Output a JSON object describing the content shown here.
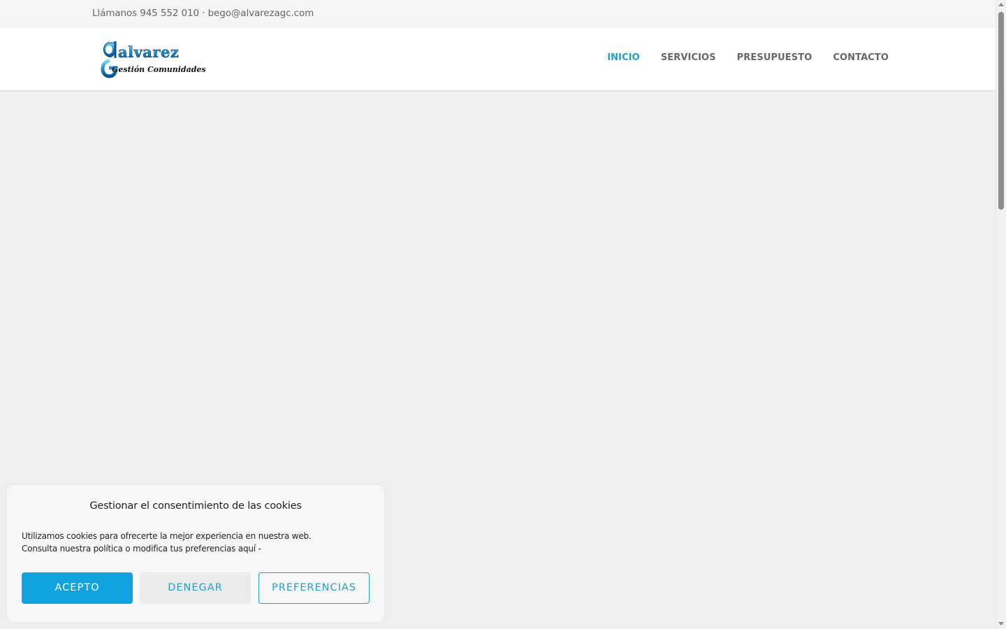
{
  "topbar": {
    "contact_text": "Llámanos 945 552 010 · bego@alvarezagc.com"
  },
  "header": {
    "logo": {
      "line1": "alvarez",
      "line2": "Gestión Comunidades"
    },
    "nav": [
      {
        "label": "INICIO",
        "active": true
      },
      {
        "label": "SERVICIOS",
        "active": false
      },
      {
        "label": "PRESUPUESTO",
        "active": false
      },
      {
        "label": "CONTACTO",
        "active": false
      }
    ]
  },
  "cookie_banner": {
    "title": "Gestionar el consentimiento de las cookies",
    "text_line1": "Utilizamos cookies para ofrecerte la mejor experiencia en nuestra web.",
    "text_line2": "Consulta nuestra política o modifica tus preferencias aquí -",
    "accept_label": "ACEPTO",
    "deny_label": "DENEGAR",
    "preferences_label": "PREFERENCIAS"
  },
  "colors": {
    "accent": "#1e9fd2",
    "accept_bg": "#11a3e0",
    "nav_text": "#666666",
    "page_bg": "#efefef"
  }
}
